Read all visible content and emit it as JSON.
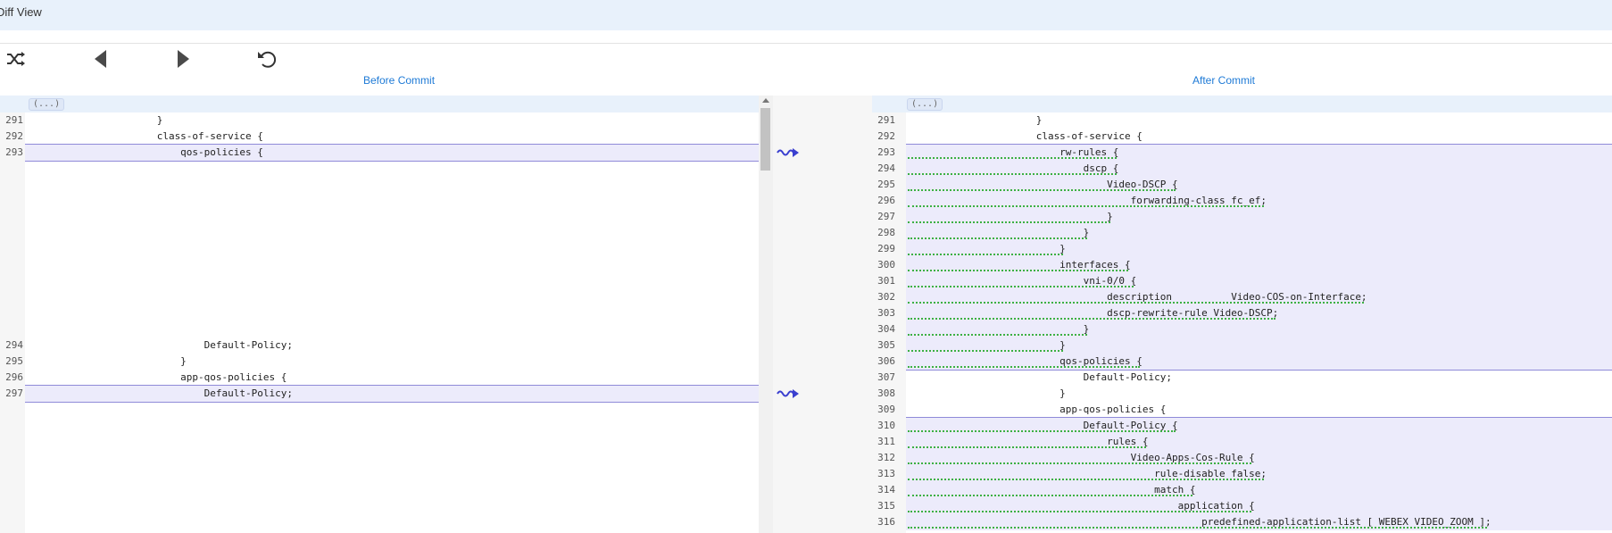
{
  "window": {
    "title": "Diff View"
  },
  "toolbar": {
    "shuffle_icon": "shuffle-icon",
    "prev_icon": "previous-icon",
    "next_icon": "next-icon",
    "undo_icon": "undo-icon"
  },
  "left": {
    "header": "Before Commit",
    "fold": "(...)",
    "lines": [
      {
        "n": "291",
        "t": "                      }"
      },
      {
        "n": "292",
        "t": "                      class-of-service {"
      },
      {
        "n": "293",
        "t": "                          qos-policies {"
      },
      {
        "n": "294",
        "t": "                              Default-Policy;"
      },
      {
        "n": "295",
        "t": "                          }"
      },
      {
        "n": "296",
        "t": "                          app-qos-policies {"
      },
      {
        "n": "297",
        "t": "                              Default-Policy;"
      }
    ]
  },
  "right": {
    "header": "After Commit",
    "fold": "(...)",
    "lines": [
      {
        "n": "291",
        "t": "                      }"
      },
      {
        "n": "292",
        "t": "                      class-of-service {"
      },
      {
        "n": "293",
        "t": "                          rw-rules {"
      },
      {
        "n": "294",
        "t": "                              dscp {"
      },
      {
        "n": "295",
        "t": "                                  Video-DSCP {"
      },
      {
        "n": "296",
        "t": "                                      forwarding-class fc_ef;"
      },
      {
        "n": "297",
        "t": "                                  }"
      },
      {
        "n": "298",
        "t": "                              }"
      },
      {
        "n": "299",
        "t": "                          }"
      },
      {
        "n": "300",
        "t": "                          interfaces {"
      },
      {
        "n": "301",
        "t": "                              vni-0/0 {"
      },
      {
        "n": "302",
        "t": "                                  description          Video-COS-on-Interface;"
      },
      {
        "n": "303",
        "t": "                                  dscp-rewrite-rule Video-DSCP;"
      },
      {
        "n": "304",
        "t": "                              }"
      },
      {
        "n": "305",
        "t": "                          }"
      },
      {
        "n": "306",
        "t": "                          qos-policies {"
      },
      {
        "n": "307",
        "t": "                              Default-Policy;"
      },
      {
        "n": "308",
        "t": "                          }"
      },
      {
        "n": "309",
        "t": "                          app-qos-policies {"
      },
      {
        "n": "310",
        "t": "                              Default-Policy {"
      },
      {
        "n": "311",
        "t": "                                  rules {"
      },
      {
        "n": "312",
        "t": "                                      Video-Apps-Cos-Rule {"
      },
      {
        "n": "313",
        "t": "                                          rule-disable false;"
      },
      {
        "n": "314",
        "t": "                                          match {"
      },
      {
        "n": "315",
        "t": "                                              application {"
      },
      {
        "n": "316",
        "t": "                                                  predefined-application-list [ WEBEX VIDEO_ZOOM ];"
      }
    ]
  },
  "colors": {
    "accent": "#1e7ad6",
    "change_bg": "#ecebfb",
    "change_border": "#8f8ad8",
    "added_underline": "#3cb043",
    "arrow": "#3a3fcf"
  }
}
